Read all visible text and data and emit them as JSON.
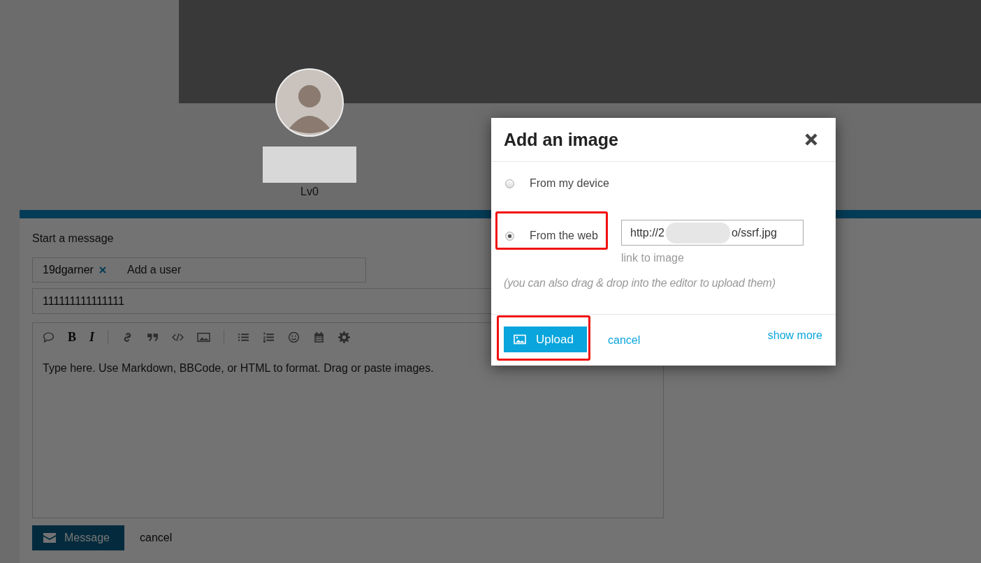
{
  "profile": {
    "level": "Lv0"
  },
  "composer": {
    "heading": "Start a message",
    "recipients": [
      {
        "name": "19dgarner"
      }
    ],
    "recipient_placeholder": "Add a user",
    "title_value": "111111111111111",
    "toolbar": [
      {
        "kind": "comment"
      },
      {
        "kind": "bold",
        "label": "B"
      },
      {
        "kind": "italic",
        "label": "I"
      },
      {
        "kind": "separator"
      },
      {
        "kind": "link"
      },
      {
        "kind": "quote"
      },
      {
        "kind": "code"
      },
      {
        "kind": "image"
      },
      {
        "kind": "separator"
      },
      {
        "kind": "bullets"
      },
      {
        "kind": "numbers"
      },
      {
        "kind": "smiley"
      },
      {
        "kind": "calendar"
      },
      {
        "kind": "gear"
      }
    ],
    "editor_placeholder": "Type here. Use Markdown, BBCode, or HTML to format. Drag or paste images.",
    "send_button": "Message",
    "cancel": "cancel"
  },
  "dialog": {
    "title": "Add an image",
    "options": [
      {
        "label": "From my device",
        "selected": false
      },
      {
        "label": "From the web",
        "selected": true
      }
    ],
    "url_field": {
      "value_start": "http://2",
      "value_end": "o/ssrf.jpg",
      "hint": "link to image"
    },
    "note": "(you can also drag & drop into the editor to upload them)",
    "upload_button": "Upload",
    "cancel": "cancel",
    "show_more": "show more"
  }
}
